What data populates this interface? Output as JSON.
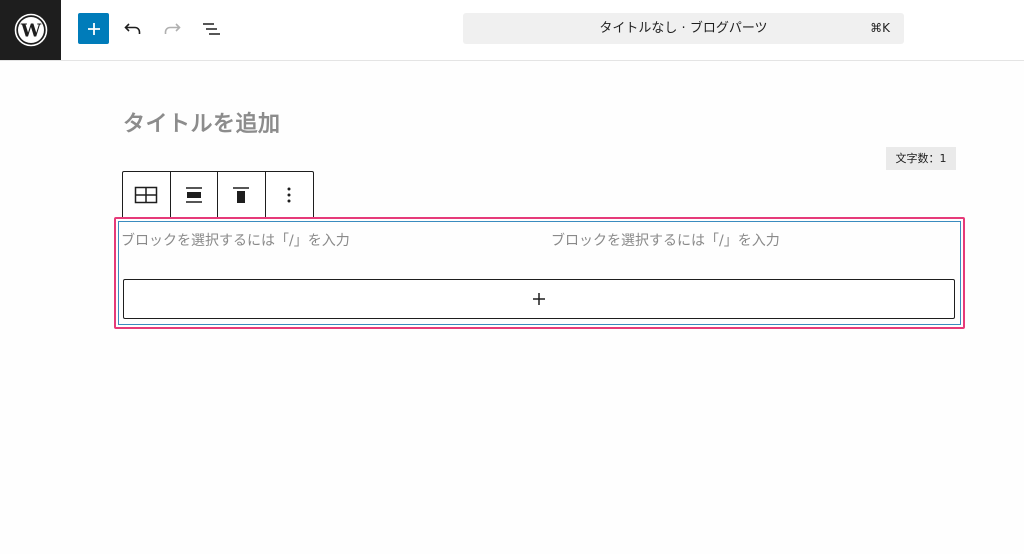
{
  "header": {
    "logo_icon": "wordpress-logo-icon",
    "add_block_icon": "plus-icon",
    "undo_icon": "undo-icon",
    "redo_icon": "redo-icon",
    "document_overview_icon": "list-view-icon",
    "command_bar": {
      "title": "タイトルなし · ブログパーツ",
      "shortcut": "⌘K"
    }
  },
  "editor": {
    "title_placeholder": "タイトルを追加",
    "char_count": "文字数：1",
    "block_toolbar": {
      "items": [
        "columns-icon",
        "vertical-align-center-icon",
        "vertical-align-top-icon",
        "more-options-icon"
      ]
    },
    "columns": [
      {
        "placeholder": "ブロックを選択するには「/」を入力"
      },
      {
        "placeholder": "ブロックを選択するには「/」を入力"
      }
    ],
    "appender_icon": "plus-icon"
  },
  "colors": {
    "accent": "#007cba",
    "highlight": "#e63a79",
    "block_border": "#3a8bbf",
    "logo_bg": "#1e1e1e"
  }
}
